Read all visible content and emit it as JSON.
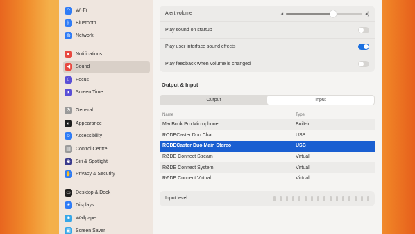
{
  "sidebar": {
    "group1": [
      {
        "label": "Wi-Fi",
        "icon": "wifi-icon",
        "color": "#2f7cf6",
        "glyph": "◠"
      },
      {
        "label": "Bluetooth",
        "icon": "bluetooth-icon",
        "color": "#2f7cf6",
        "glyph": "ᛒ"
      },
      {
        "label": "Network",
        "icon": "network-icon",
        "color": "#2f7cf6",
        "glyph": "◍"
      }
    ],
    "group2": [
      {
        "label": "Notifications",
        "icon": "notifications-icon",
        "color": "#e8483f",
        "glyph": "●"
      },
      {
        "label": "Sound",
        "icon": "sound-icon",
        "color": "#e8483f",
        "glyph": "◀",
        "selected": true
      },
      {
        "label": "Focus",
        "icon": "focus-icon",
        "color": "#5a4fd6",
        "glyph": "☾"
      },
      {
        "label": "Screen Time",
        "icon": "screen-time-icon",
        "color": "#5a4fd6",
        "glyph": "⧗"
      }
    ],
    "group3": [
      {
        "label": "General",
        "icon": "gear-icon",
        "color": "#9a9a9a",
        "glyph": "⚙"
      },
      {
        "label": "Appearance",
        "icon": "appearance-icon",
        "color": "#1f1f1f",
        "glyph": "◐"
      },
      {
        "label": "Accessibility",
        "icon": "accessibility-icon",
        "color": "#2f7cf6",
        "glyph": "☺"
      },
      {
        "label": "Control Centre",
        "icon": "control-centre-icon",
        "color": "#9a9a9a",
        "glyph": "▤"
      },
      {
        "label": "Siri & Spotlight",
        "icon": "siri-icon",
        "color": "#3a3a8c",
        "glyph": "◉"
      },
      {
        "label": "Privacy & Security",
        "icon": "hand-icon",
        "color": "#2f7cf6",
        "glyph": "✋"
      }
    ],
    "group4": [
      {
        "label": "Desktop & Dock",
        "icon": "desktop-dock-icon",
        "color": "#1f1f1f",
        "glyph": "▭"
      },
      {
        "label": "Displays",
        "icon": "displays-icon",
        "color": "#2f7cf6",
        "glyph": "☀"
      },
      {
        "label": "Wallpaper",
        "icon": "wallpaper-icon",
        "color": "#36a7e8",
        "glyph": "❀"
      },
      {
        "label": "Screen Saver",
        "icon": "screen-saver-icon",
        "color": "#36a7e8",
        "glyph": "▣"
      }
    ]
  },
  "sound": {
    "alert_volume_label": "Alert volume",
    "alert_volume_level": 0.62,
    "play_startup_label": "Play sound on startup",
    "play_startup_on": false,
    "ui_effects_label": "Play user interface sound effects",
    "ui_effects_on": true,
    "feedback_label": "Play feedback when volume is changed",
    "feedback_on": false
  },
  "output_input": {
    "title": "Output & Input",
    "tab_output": "Output",
    "tab_input": "Input",
    "active_tab": "Input",
    "col_name": "Name",
    "col_type": "Type",
    "devices": [
      {
        "name": "MacBook Pro Microphone",
        "type": "Built-in"
      },
      {
        "name": "RODECaster Duo Chat",
        "type": "USB"
      },
      {
        "name": "RODECaster Duo Main Stereo",
        "type": "USB",
        "selected": true
      },
      {
        "name": "RØDE Connect Stream",
        "type": "Virtual"
      },
      {
        "name": "RØDE Connect System",
        "type": "Virtual"
      },
      {
        "name": "RØDE Connect Virtual",
        "type": "Virtual"
      }
    ],
    "input_level_label": "Input level"
  },
  "colors": {
    "accent": "#1a5fd1",
    "toggle_on": "#1a6fe0"
  }
}
